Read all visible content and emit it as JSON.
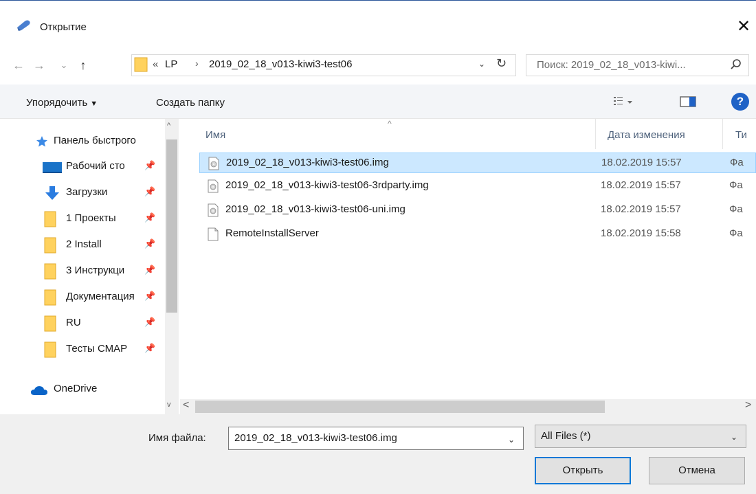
{
  "window": {
    "title": "Открытие",
    "close_glyph": "✕",
    "icon": "open-dialog-icon"
  },
  "nav": {
    "back_glyph": "←",
    "forward_glyph": "→",
    "recent_glyph": "⌄",
    "up_glyph": "↑",
    "breadcrumb_prefix": "«",
    "breadcrumb": [
      "LP",
      "2019_02_18_v013-kiwi3-test06"
    ],
    "separator": "›",
    "dropdown_glyph": "⌄",
    "refresh_glyph": "↻",
    "search_placeholder": "Поиск: 2019_02_18_v013-kiwi..."
  },
  "toolbar": {
    "organize_label": "Упорядочить",
    "organize_caret": "▼",
    "new_folder_label": "Создать папку",
    "view_caret": "▼",
    "help_label": "?"
  },
  "sidebar": {
    "quick_access": "Панель быстрого",
    "items": [
      {
        "label": "Рабочий сто",
        "icon": "desktop-icon",
        "pinned": true
      },
      {
        "label": "Загрузки",
        "icon": "downloads-icon",
        "pinned": true
      },
      {
        "label": "1 Проекты",
        "icon": "folder-icon",
        "pinned": true
      },
      {
        "label": "2 Install",
        "icon": "folder-icon",
        "pinned": true
      },
      {
        "label": "3 Инструкци",
        "icon": "folder-icon",
        "pinned": true
      },
      {
        "label": "Документация",
        "icon": "folder-icon",
        "pinned": true
      },
      {
        "label": "RU",
        "icon": "folder-icon",
        "pinned": true
      },
      {
        "label": "Тесты СМАР",
        "icon": "folder-icon",
        "pinned": true
      }
    ],
    "onedrive": "OneDrive",
    "pin_glyph": "📌"
  },
  "columns": {
    "name": "Имя",
    "date": "Дата изменения",
    "type": "Ти"
  },
  "files": [
    {
      "name": "2019_02_18_v013-kiwi3-test06.img",
      "date": "18.02.2019 15:57",
      "type": "Фа",
      "icon": "disc-image-icon",
      "selected": true
    },
    {
      "name": "2019_02_18_v013-kiwi3-test06-3rdparty.img",
      "date": "18.02.2019 15:57",
      "type": "Фа",
      "icon": "disc-image-icon",
      "selected": false
    },
    {
      "name": "2019_02_18_v013-kiwi3-test06-uni.img",
      "date": "18.02.2019 15:57",
      "type": "Фа",
      "icon": "disc-image-icon",
      "selected": false
    },
    {
      "name": "RemoteInstallServer",
      "date": "18.02.2019 15:58",
      "type": "Фа",
      "icon": "file-icon",
      "selected": false
    }
  ],
  "scroll": {
    "up_glyph": "^",
    "down_glyph": "v",
    "left_glyph": "<",
    "right_glyph": ">"
  },
  "bottom": {
    "filename_label": "Имя файла:",
    "filename_value": "2019_02_18_v013-kiwi3-test06.img",
    "filetype_value": "All Files (*)",
    "dropdown_glyph": "⌄",
    "open_label": "Открыть",
    "cancel_label": "Отмена"
  },
  "colors": {
    "selection_bg": "#cce8ff",
    "selection_border": "#99d1ff",
    "accent": "#0078d7",
    "folder": "#ffd25e",
    "help_blue": "#1f62c6"
  }
}
